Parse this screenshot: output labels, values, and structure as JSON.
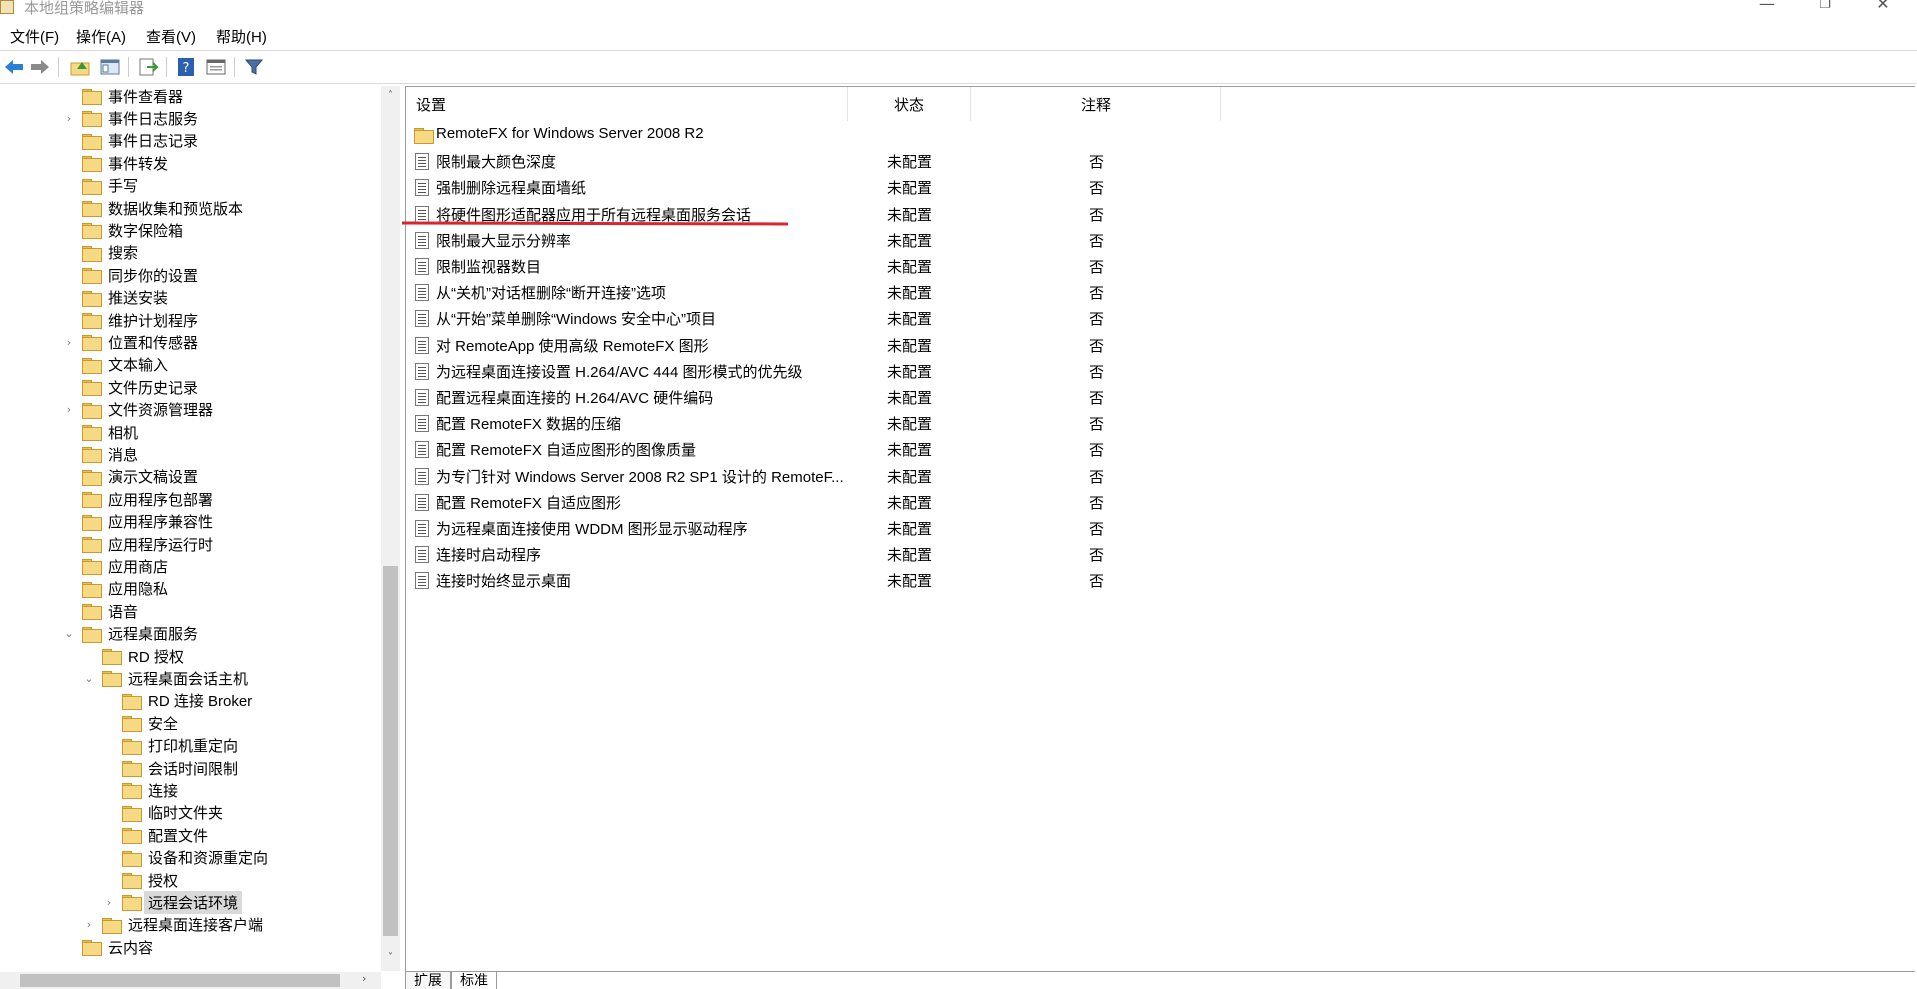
{
  "window": {
    "title": "本地组策略编辑器",
    "min": "—",
    "max": "❐",
    "close": "✕"
  },
  "menu": [
    "文件(F)",
    "操作(A)",
    "查看(V)",
    "帮助(H)"
  ],
  "toolbar": {
    "icons": [
      "back-icon",
      "forward-icon",
      "up-folder-icon",
      "show-hide-tree-icon",
      "export-list-icon",
      "help-icon",
      "properties-icon",
      "filter-icon"
    ]
  },
  "tree": {
    "items": [
      {
        "label": "事件查看器",
        "level": 0,
        "expander": ""
      },
      {
        "label": "事件日志服务",
        "level": 0,
        "expander": "›"
      },
      {
        "label": "事件日志记录",
        "level": 0,
        "expander": ""
      },
      {
        "label": "事件转发",
        "level": 0,
        "expander": ""
      },
      {
        "label": "手写",
        "level": 0,
        "expander": ""
      },
      {
        "label": "数据收集和预览版本",
        "level": 0,
        "expander": ""
      },
      {
        "label": "数字保险箱",
        "level": 0,
        "expander": ""
      },
      {
        "label": "搜索",
        "level": 0,
        "expander": ""
      },
      {
        "label": "同步你的设置",
        "level": 0,
        "expander": ""
      },
      {
        "label": "推送安装",
        "level": 0,
        "expander": ""
      },
      {
        "label": "维护计划程序",
        "level": 0,
        "expander": ""
      },
      {
        "label": "位置和传感器",
        "level": 0,
        "expander": "›"
      },
      {
        "label": "文本输入",
        "level": 0,
        "expander": ""
      },
      {
        "label": "文件历史记录",
        "level": 0,
        "expander": ""
      },
      {
        "label": "文件资源管理器",
        "level": 0,
        "expander": "›"
      },
      {
        "label": "相机",
        "level": 0,
        "expander": ""
      },
      {
        "label": "消息",
        "level": 0,
        "expander": ""
      },
      {
        "label": "演示文稿设置",
        "level": 0,
        "expander": ""
      },
      {
        "label": "应用程序包部署",
        "level": 0,
        "expander": ""
      },
      {
        "label": "应用程序兼容性",
        "level": 0,
        "expander": ""
      },
      {
        "label": "应用程序运行时",
        "level": 0,
        "expander": ""
      },
      {
        "label": "应用商店",
        "level": 0,
        "expander": ""
      },
      {
        "label": "应用隐私",
        "level": 0,
        "expander": ""
      },
      {
        "label": "语音",
        "level": 0,
        "expander": ""
      },
      {
        "label": "远程桌面服务",
        "level": 0,
        "expander": "⌄"
      },
      {
        "label": "RD 授权",
        "level": 1,
        "expander": ""
      },
      {
        "label": "远程桌面会话主机",
        "level": 1,
        "expander": "⌄"
      },
      {
        "label": "RD 连接 Broker",
        "level": 2,
        "expander": ""
      },
      {
        "label": "安全",
        "level": 2,
        "expander": ""
      },
      {
        "label": "打印机重定向",
        "level": 2,
        "expander": ""
      },
      {
        "label": "会话时间限制",
        "level": 2,
        "expander": ""
      },
      {
        "label": "连接",
        "level": 2,
        "expander": ""
      },
      {
        "label": "临时文件夹",
        "level": 2,
        "expander": ""
      },
      {
        "label": "配置文件",
        "level": 2,
        "expander": ""
      },
      {
        "label": "设备和资源重定向",
        "level": 2,
        "expander": ""
      },
      {
        "label": "授权",
        "level": 2,
        "expander": ""
      },
      {
        "label": "远程会话环境",
        "level": 2,
        "expander": "›",
        "selected": true
      },
      {
        "label": "远程桌面连接客户端",
        "level": 1,
        "expander": "›"
      },
      {
        "label": "云内容",
        "level": 0,
        "expander": ""
      }
    ]
  },
  "list": {
    "columns": {
      "setting": "设置",
      "state": "状态",
      "comment": "注释"
    },
    "rows": [
      {
        "name": "RemoteFX for Windows Server 2008 R2",
        "state": "",
        "note": "",
        "folder": true
      },
      {
        "name": "限制最大颜色深度",
        "state": "未配置",
        "note": "否"
      },
      {
        "name": "强制删除远程桌面墙纸",
        "state": "未配置",
        "note": "否"
      },
      {
        "name": "将硬件图形适配器应用于所有远程桌面服务会话",
        "state": "未配置",
        "note": "否",
        "underlined": true
      },
      {
        "name": "限制最大显示分辨率",
        "state": "未配置",
        "note": "否"
      },
      {
        "name": "限制监视器数目",
        "state": "未配置",
        "note": "否"
      },
      {
        "name": "从“关机”对话框删除“断开连接”选项",
        "state": "未配置",
        "note": "否"
      },
      {
        "name": "从“开始”菜单删除“Windows 安全中心”项目",
        "state": "未配置",
        "note": "否"
      },
      {
        "name": "对 RemoteApp 使用高级 RemoteFX 图形",
        "state": "未配置",
        "note": "否"
      },
      {
        "name": "为远程桌面连接设置 H.264/AVC 444 图形模式的优先级",
        "state": "未配置",
        "note": "否"
      },
      {
        "name": "配置远程桌面连接的 H.264/AVC 硬件编码",
        "state": "未配置",
        "note": "否"
      },
      {
        "name": "配置 RemoteFX 数据的压缩",
        "state": "未配置",
        "note": "否"
      },
      {
        "name": "配置 RemoteFX 自适应图形的图像质量",
        "state": "未配置",
        "note": "否"
      },
      {
        "name": "为专门针对 Windows Server 2008 R2 SP1 设计的 RemoteF...",
        "state": "未配置",
        "note": "否"
      },
      {
        "name": "配置 RemoteFX 自适应图形",
        "state": "未配置",
        "note": "否"
      },
      {
        "name": "为远程桌面连接使用 WDDM 图形显示驱动程序",
        "state": "未配置",
        "note": "否"
      },
      {
        "name": "连接时启动程序",
        "state": "未配置",
        "note": "否"
      },
      {
        "name": "连接时始终显示桌面",
        "state": "未配置",
        "note": "否"
      }
    ]
  },
  "tabs": [
    "扩展",
    "标准"
  ],
  "scroll": {
    "up": "˄",
    "down": "˅",
    "right": "›"
  },
  "annotation_color": "#d9262e"
}
